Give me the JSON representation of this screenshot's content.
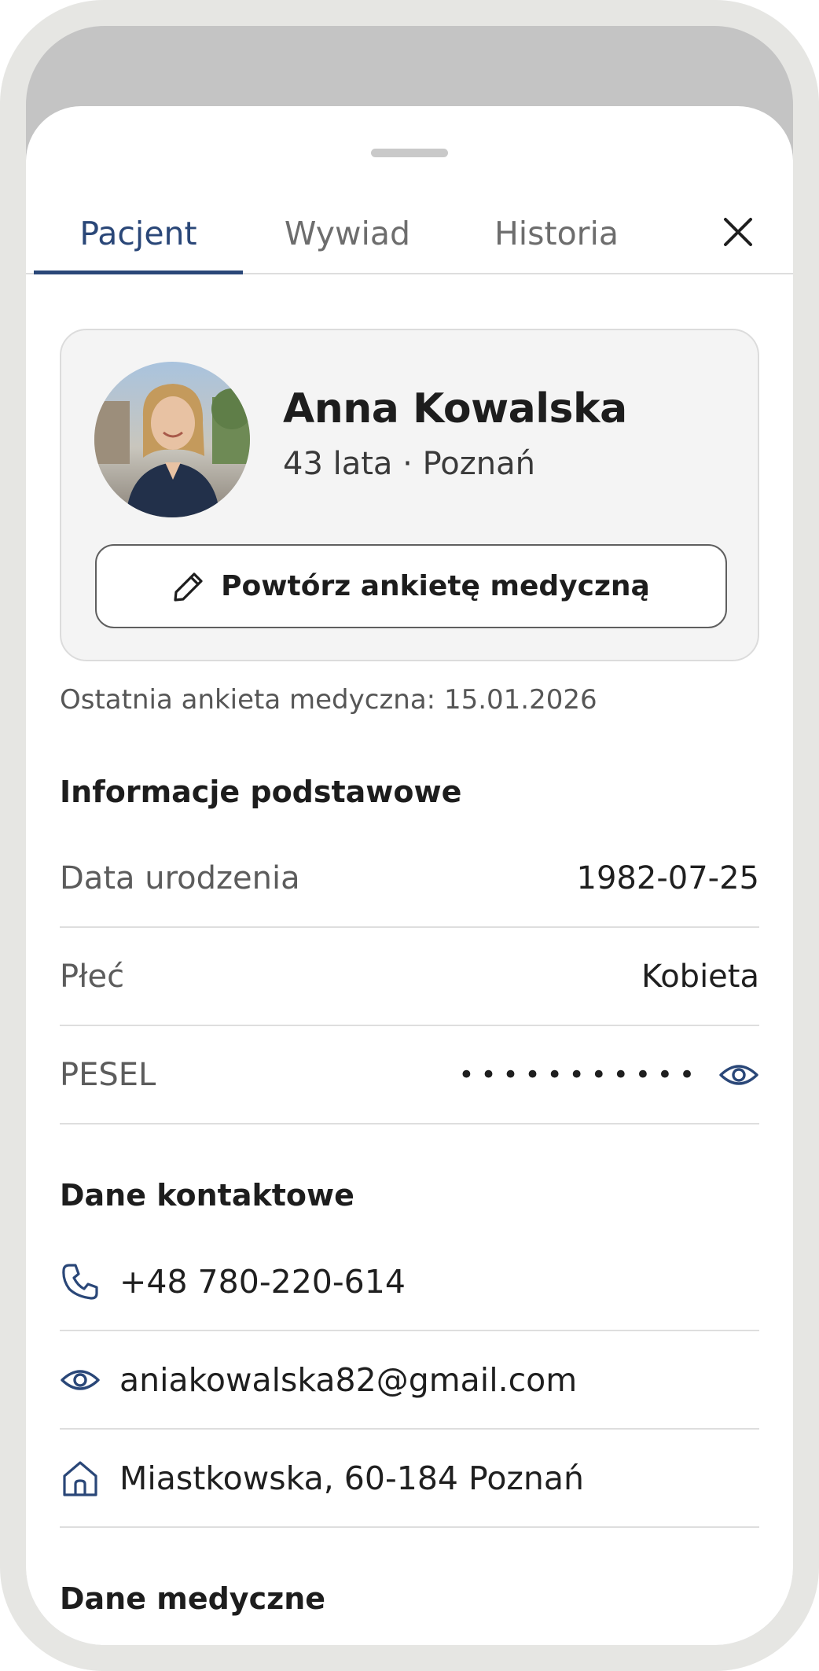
{
  "tabs": [
    {
      "label": "Pacjent",
      "active": true
    },
    {
      "label": "Wywiad",
      "active": false
    },
    {
      "label": "Historia",
      "active": false
    }
  ],
  "icons": {
    "close": "close-icon",
    "edit": "pencil-icon",
    "reveal": "eye-icon",
    "phone": "phone-icon",
    "email": "eye-icon",
    "address": "home-icon"
  },
  "patient": {
    "name": "Anna Kowalska",
    "meta": "43 lata · Poznań",
    "repeat_button_label": "Powtórz ankietę medyczną",
    "last_survey": "Ostatnia ankieta medyczna: 15.01.2026"
  },
  "basic_info": {
    "title": "Informacje podstawowe",
    "rows": [
      {
        "label": "Data urodzenia",
        "value": "1982-07-25"
      },
      {
        "label": "Płeć",
        "value": "Kobieta"
      },
      {
        "label": "PESEL",
        "value": "•••••••••••"
      }
    ]
  },
  "contact": {
    "title": "Dane kontaktowe",
    "phone": "+48 780-220-614",
    "email": "aniakowalska82@gmail.com",
    "address": "Miastkowska, 60-184 Poznań"
  },
  "medical": {
    "title": "Dane medyczne"
  },
  "colors": {
    "accent": "#2a4778",
    "card_bg": "#f4f4f4",
    "divider": "#dedede"
  }
}
